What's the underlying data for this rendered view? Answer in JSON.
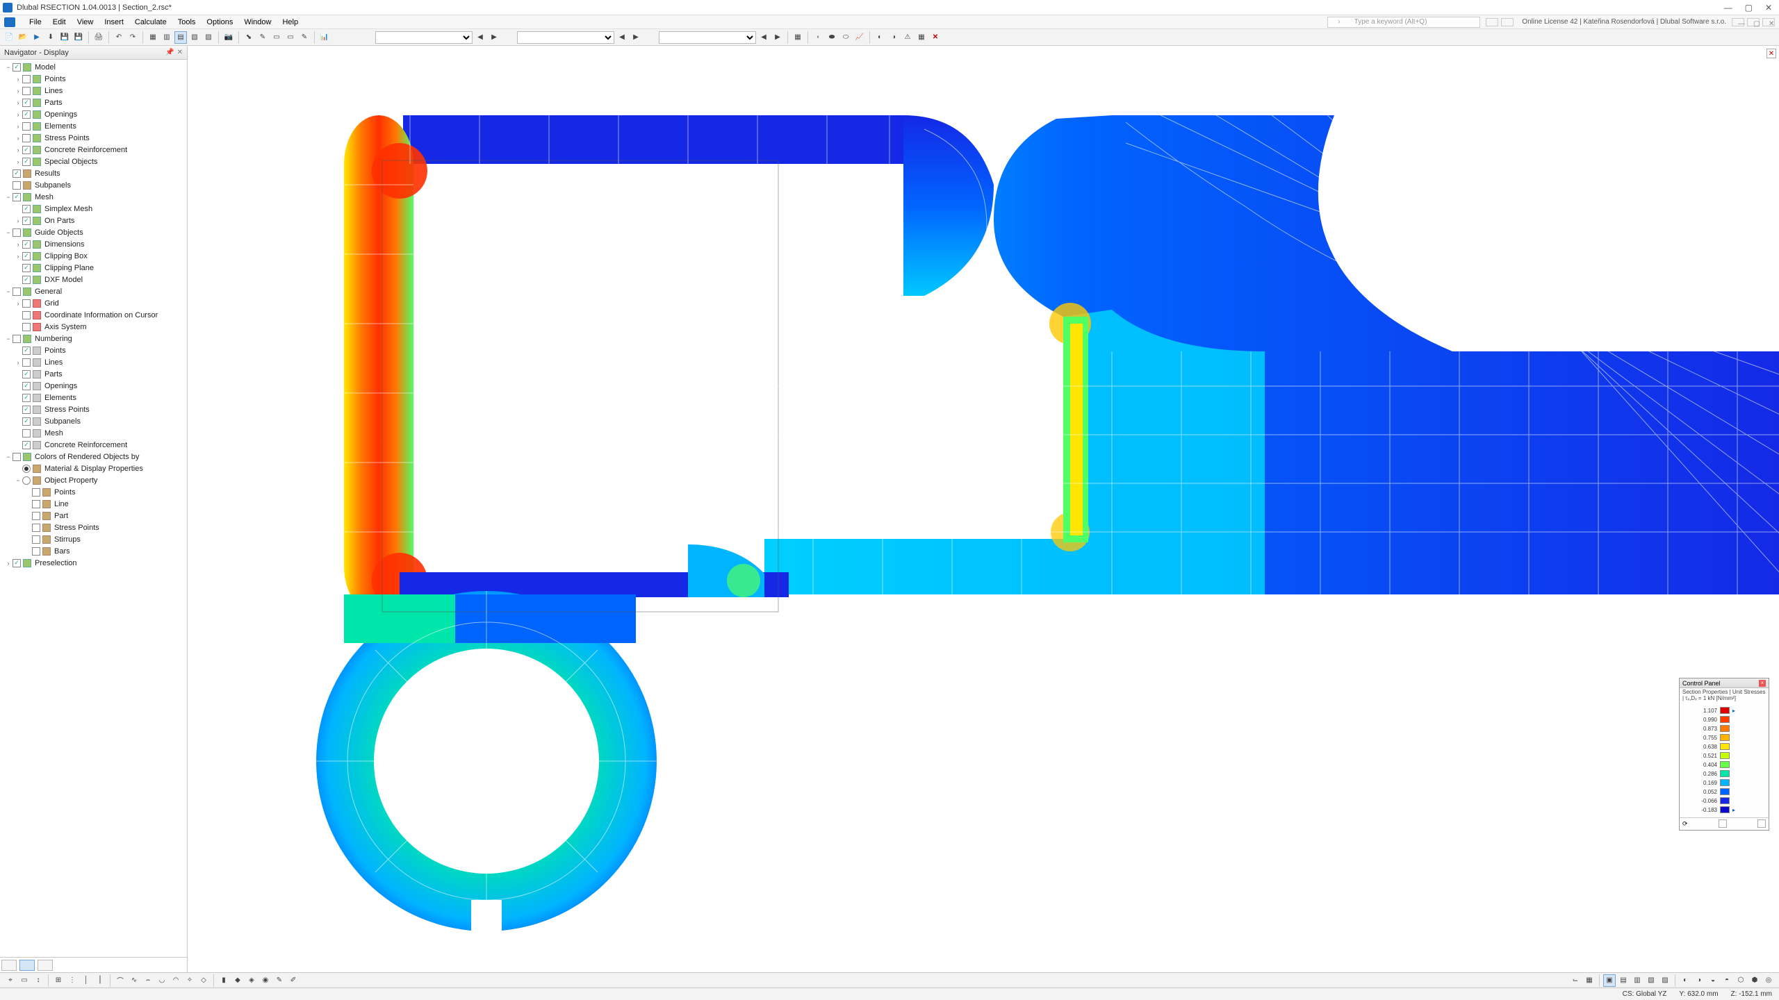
{
  "title": "Dlubal RSECTION 1.04.0013 | Section_2.rsc*",
  "menu": [
    "File",
    "Edit",
    "View",
    "Insert",
    "Calculate",
    "Tools",
    "Options",
    "Window",
    "Help"
  ],
  "search_placeholder": "Type a keyword (Alt+Q)",
  "license": "Online License 42 | Kateřina Rosendorfová | Dlubal Software s.r.o.",
  "nav_header": "Navigator - Display",
  "tree": [
    {
      "lvl": 0,
      "tw": "−",
      "cb": true,
      "ic": "",
      "lbl": "Model"
    },
    {
      "lvl": 1,
      "tw": "›",
      "cb": false,
      "ic": "",
      "lbl": "Points"
    },
    {
      "lvl": 1,
      "tw": "›",
      "cb": false,
      "ic": "",
      "lbl": "Lines"
    },
    {
      "lvl": 1,
      "tw": "›",
      "cb": true,
      "ic": "",
      "lbl": "Parts"
    },
    {
      "lvl": 1,
      "tw": "›",
      "cb": true,
      "ic": "",
      "lbl": "Openings"
    },
    {
      "lvl": 1,
      "tw": "›",
      "cb": false,
      "ic": "",
      "lbl": "Elements"
    },
    {
      "lvl": 1,
      "tw": "›",
      "cb": false,
      "ic": "",
      "lbl": "Stress Points"
    },
    {
      "lvl": 1,
      "tw": "›",
      "cb": true,
      "ic": "",
      "lbl": "Concrete Reinforcement"
    },
    {
      "lvl": 1,
      "tw": "›",
      "cb": true,
      "ic": "",
      "lbl": "Special Objects"
    },
    {
      "lvl": 0,
      "tw": " ",
      "cb": true,
      "ic": "b",
      "lbl": "Results"
    },
    {
      "lvl": 0,
      "tw": " ",
      "cb": false,
      "ic": "b",
      "lbl": "Subpanels"
    },
    {
      "lvl": 0,
      "tw": "−",
      "cb": true,
      "ic": "",
      "lbl": "Mesh"
    },
    {
      "lvl": 1,
      "tw": " ",
      "cb": true,
      "ic": "",
      "lbl": "Simplex Mesh"
    },
    {
      "lvl": 1,
      "tw": "›",
      "cb": true,
      "ic": "",
      "lbl": "On Parts"
    },
    {
      "lvl": 0,
      "tw": "−",
      "cb": false,
      "ic": "",
      "lbl": "Guide Objects"
    },
    {
      "lvl": 1,
      "tw": "›",
      "cb": true,
      "ic": "",
      "lbl": "Dimensions"
    },
    {
      "lvl": 1,
      "tw": "›",
      "cb": true,
      "ic": "",
      "lbl": "Clipping Box"
    },
    {
      "lvl": 1,
      "tw": " ",
      "cb": true,
      "ic": "",
      "lbl": "Clipping Plane"
    },
    {
      "lvl": 1,
      "tw": " ",
      "cb": true,
      "ic": "",
      "lbl": "DXF Model"
    },
    {
      "lvl": 0,
      "tw": "−",
      "cb": false,
      "ic": "",
      "lbl": "General"
    },
    {
      "lvl": 1,
      "tw": "›",
      "cb": false,
      "ic": "r",
      "lbl": "Grid"
    },
    {
      "lvl": 1,
      "tw": " ",
      "cb": false,
      "ic": "r",
      "lbl": "Coordinate Information on Cursor"
    },
    {
      "lvl": 1,
      "tw": " ",
      "cb": false,
      "ic": "r",
      "lbl": "Axis System"
    },
    {
      "lvl": 0,
      "tw": "−",
      "cb": false,
      "ic": "",
      "lbl": "Numbering"
    },
    {
      "lvl": 1,
      "tw": " ",
      "cb": true,
      "ic": "g",
      "lbl": "Points"
    },
    {
      "lvl": 1,
      "tw": "›",
      "cb": false,
      "ic": "g",
      "lbl": "Lines"
    },
    {
      "lvl": 1,
      "tw": " ",
      "cb": true,
      "ic": "g",
      "lbl": "Parts"
    },
    {
      "lvl": 1,
      "tw": " ",
      "cb": true,
      "ic": "g",
      "lbl": "Openings"
    },
    {
      "lvl": 1,
      "tw": " ",
      "cb": true,
      "ic": "g",
      "lbl": "Elements"
    },
    {
      "lvl": 1,
      "tw": " ",
      "cb": true,
      "ic": "g",
      "lbl": "Stress Points"
    },
    {
      "lvl": 1,
      "tw": " ",
      "cb": true,
      "ic": "g",
      "lbl": "Subpanels"
    },
    {
      "lvl": 1,
      "tw": " ",
      "cb": false,
      "ic": "g",
      "lbl": "Mesh"
    },
    {
      "lvl": 1,
      "tw": " ",
      "cb": true,
      "ic": "g",
      "lbl": "Concrete Reinforcement"
    },
    {
      "lvl": 0,
      "tw": "−",
      "cb": false,
      "ic": "",
      "lbl": "Colors of Rendered Objects by"
    },
    {
      "lvl": 1,
      "tw": " ",
      "cb": "radio-on",
      "ic": "b",
      "lbl": "Material & Display Properties"
    },
    {
      "lvl": 1,
      "tw": "−",
      "cb": "radio",
      "ic": "b",
      "lbl": "Object Property"
    },
    {
      "lvl": 2,
      "tw": " ",
      "cb": false,
      "ic": "b",
      "lbl": "Points"
    },
    {
      "lvl": 2,
      "tw": " ",
      "cb": false,
      "ic": "b",
      "lbl": "Line"
    },
    {
      "lvl": 2,
      "tw": " ",
      "cb": false,
      "ic": "b",
      "lbl": "Part"
    },
    {
      "lvl": 2,
      "tw": " ",
      "cb": false,
      "ic": "b",
      "lbl": "Stress Points"
    },
    {
      "lvl": 2,
      "tw": " ",
      "cb": false,
      "ic": "b",
      "lbl": "Stirrups"
    },
    {
      "lvl": 2,
      "tw": " ",
      "cb": false,
      "ic": "b",
      "lbl": "Bars"
    },
    {
      "lvl": 0,
      "tw": "›",
      "cb": true,
      "ic": "",
      "lbl": "Preselection"
    }
  ],
  "control_panel": {
    "title": "Control Panel",
    "subtitle": "Section Properties | Unit Stresses | τₓ,Dₓ = 1 kN [N/mm²]",
    "legend": [
      {
        "v": "1.107",
        "c": "#e00000"
      },
      {
        "v": "0.990",
        "c": "#fa3c00"
      },
      {
        "v": "0.873",
        "c": "#ff7800"
      },
      {
        "v": "0.755",
        "c": "#ffb400"
      },
      {
        "v": "0.638",
        "c": "#ffe600"
      },
      {
        "v": "0.521",
        "c": "#c8ff00"
      },
      {
        "v": "0.404",
        "c": "#64ff46"
      },
      {
        "v": "0.286",
        "c": "#00e6aa"
      },
      {
        "v": "0.169",
        "c": "#00b4ff"
      },
      {
        "v": "0.052",
        "c": "#0064ff"
      },
      {
        "v": "-0.066",
        "c": "#1428e6"
      },
      {
        "v": "-0.183",
        "c": "#0a0ac8"
      }
    ],
    "footer": "⟳"
  },
  "status": {
    "cs": "CS: Global YZ",
    "y": "Y: 632.0 mm",
    "z": "Z: -152.1 mm"
  }
}
